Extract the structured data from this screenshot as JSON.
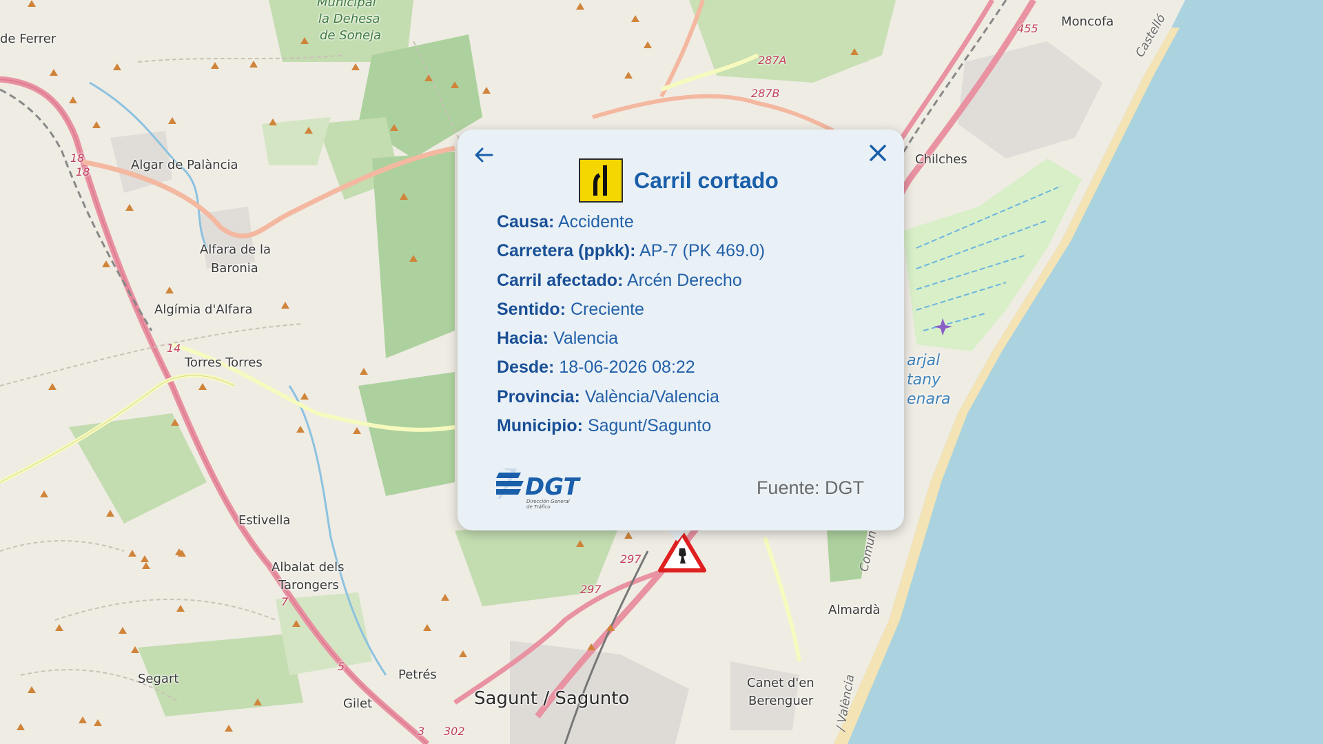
{
  "map": {
    "places": {
      "ferrer": "de Ferrer",
      "municipal": "Municipal",
      "dehesa": "la Dehesa",
      "soneja": "de Soneja",
      "moncofa": "Moncofa",
      "chilches": "Chilches",
      "algar": "Algar de Palància",
      "alfara1": "Alfara de la",
      "alfara2": "Baronia",
      "algimia": "Algímia d'Alfara",
      "torres": "Torres Torres",
      "estivella": "Estivella",
      "albalat1": "Albalat dels",
      "albalat2": "Tarongers",
      "segart": "Segart",
      "petres": "Petrés",
      "gilet": "Gilet",
      "sagunt": "Sagunt / Sagunto",
      "almarda": "Almardà",
      "canet1": "Canet d'en",
      "canet2": "Berenguer",
      "marjal": "arjal",
      "estany": "tany",
      "almenara": "enara"
    },
    "roads": {
      "r287a": "287A",
      "r287b": "287B",
      "r455": "455",
      "r18a": "18",
      "r18b": "18",
      "r14": "14",
      "r297a": "297",
      "r297b": "297",
      "r302": "302",
      "r7": "7",
      "r5": "5",
      "r3": "3"
    },
    "coast": {
      "castello": "Castelló",
      "comun": "Comun",
      "valencia": "/ València"
    }
  },
  "popup": {
    "title": "Carril cortado",
    "rows": [
      {
        "key": "Causa:",
        "value": "Accidente"
      },
      {
        "key": "Carretera (ppkk):",
        "value": "AP-7 (PK 469.0)"
      },
      {
        "key": "Carril afectado:",
        "value": "Arcén Derecho"
      },
      {
        "key": "Sentido:",
        "value": "Creciente"
      },
      {
        "key": "Hacia:",
        "value": "Valencia"
      },
      {
        "key": "Desde:",
        "value": "18-06-2026 08:22"
      },
      {
        "key": "Provincia:",
        "value": "València/Valencia"
      },
      {
        "key": "Municipio:",
        "value": "Sagunt/Sagunto"
      }
    ],
    "logo_text": "DGT",
    "logo_sub1": "Dirección General",
    "logo_sub2": "de Tráfico",
    "source": "Fuente: DGT",
    "icons": {
      "back": "arrow-left-icon",
      "close": "close-icon",
      "sign": "lane-closed-sign-icon",
      "incident": "warning-triangle-icon"
    },
    "colors": {
      "title": "#1a5faa",
      "text": "#2360a8",
      "background": "#e9f1f7",
      "sign_yellow": "#f4d600",
      "incident_red": "#e02020"
    }
  }
}
